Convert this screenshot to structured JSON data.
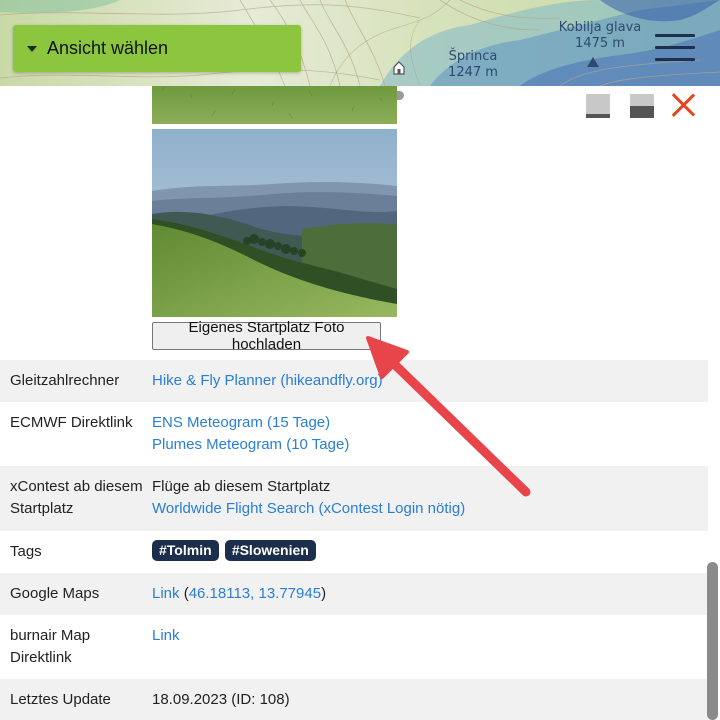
{
  "header": {
    "view_select_label": "Ansicht wählen",
    "map_labels": [
      {
        "name": "Kobilja glava",
        "elevation": "1475 m"
      },
      {
        "name": "Šprinca",
        "elevation": "1247 m"
      }
    ]
  },
  "panel": {
    "upload_button": "Eigenes Startplatz Foto hochladen",
    "rows": {
      "gleitzahl": {
        "key": "Gleitzahlrechner",
        "link": "Hike & Fly Planner (hikeandfly.org)"
      },
      "ecmwf": {
        "key": "ECMWF Direktlink",
        "link1": "ENS Meteogram (15 Tage)",
        "link2": "Plumes Meteogram (10 Tage)"
      },
      "xcontest": {
        "key": "xContest ab diesem Startplatz",
        "text": "Flüge ab diesem Startplatz",
        "link": "Worldwide Flight Search (xContest Login nötig)"
      },
      "tags": {
        "key": "Tags",
        "items": [
          "#Tolmin",
          "#Slowenien"
        ]
      },
      "google": {
        "key": "Google Maps",
        "link": "Link",
        "open": " (",
        "coords": "46.18113, 13.77945",
        "close": ")"
      },
      "burnair": {
        "key": "burnair Map Direktlink",
        "link": "Link"
      },
      "update": {
        "key": "Letztes Update",
        "value": "18.09.2023 (ID: 108)"
      }
    }
  },
  "colors": {
    "accent_green": "#8cc63f",
    "link_blue": "#2a7ed3",
    "tag_navy": "#1b2f4d",
    "close_red": "#e8441d",
    "annotation_arrow": "#e8454a"
  },
  "icons": [
    "caret-down-icon",
    "hamburger-menu-icon",
    "minimize-icon",
    "half-screen-icon",
    "close-icon",
    "mountain-peak-icon",
    "hut-icon"
  ]
}
